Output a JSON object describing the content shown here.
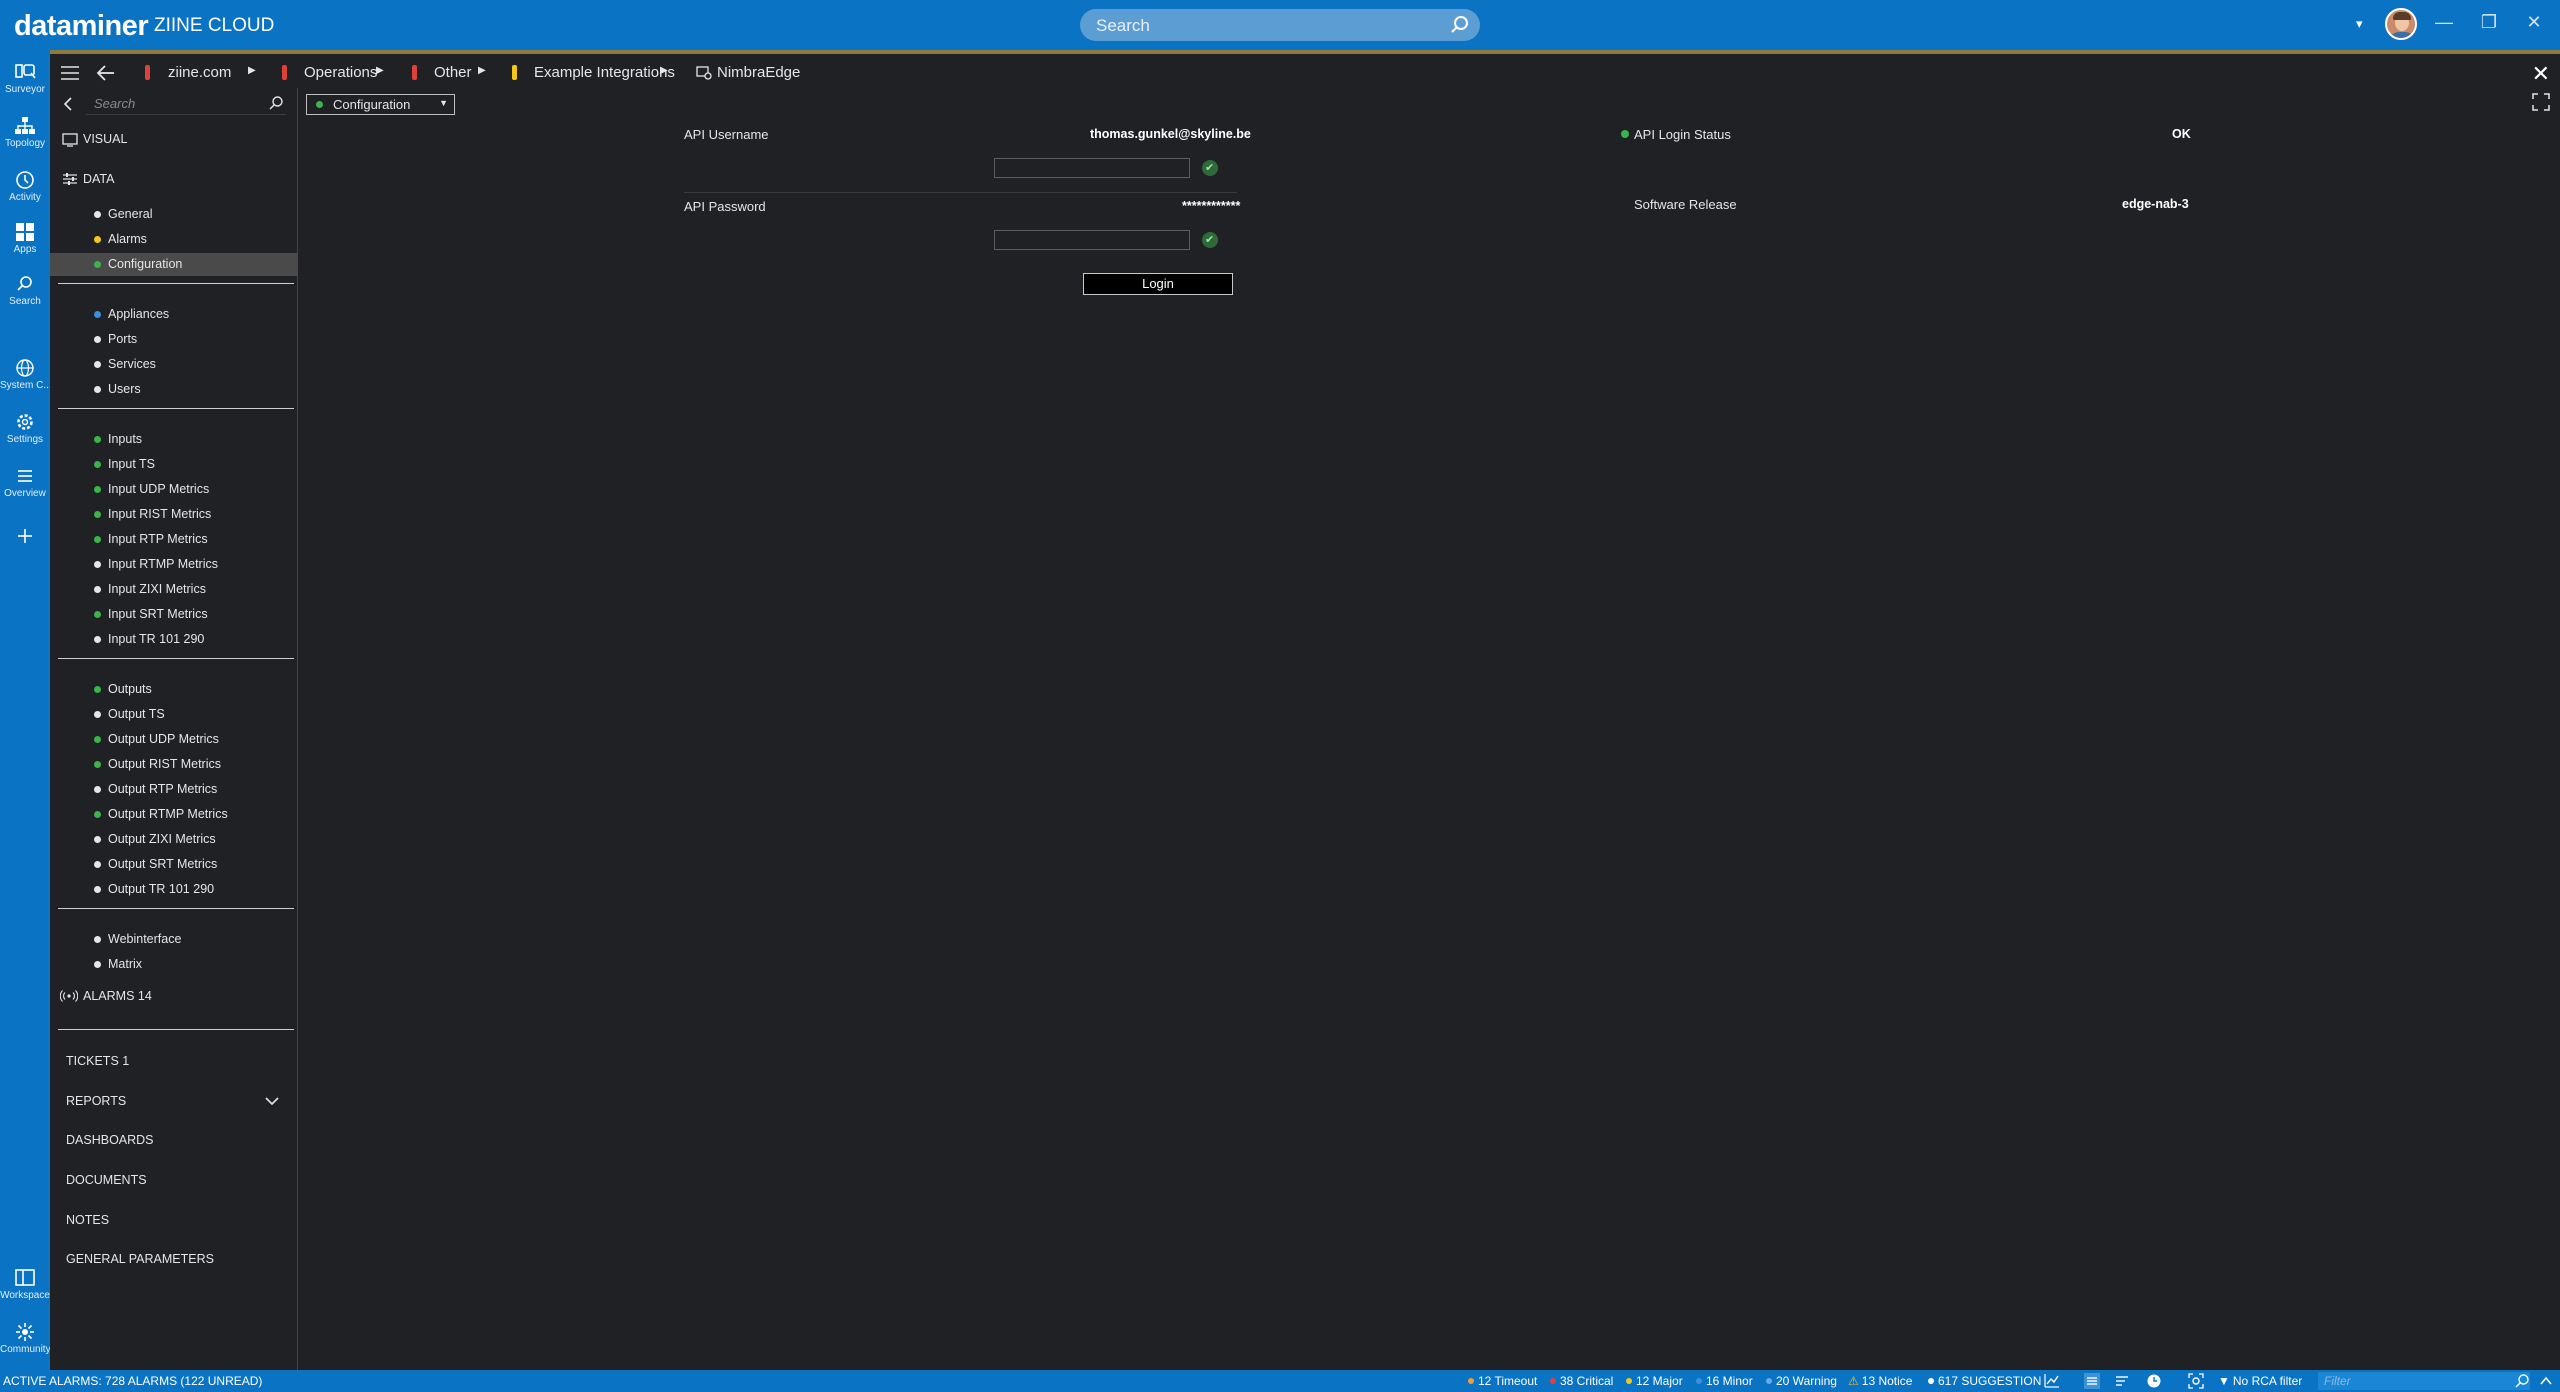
{
  "app": {
    "brand": "dataminer",
    "system_name": "ZIINE CLOUD",
    "search_placeholder": "Search",
    "colors": {
      "accent": "#0a73c4",
      "ok": "#3ab54a",
      "alarm_critical": "#e0403a",
      "alarm_major": "#f5c518",
      "alarm_minor": "#3a8fe0"
    }
  },
  "rail": {
    "items": [
      {
        "label": "Surveyor",
        "icon": "surveyor-icon"
      },
      {
        "label": "Topology",
        "icon": "topology-icon"
      },
      {
        "label": "Activity",
        "icon": "activity-icon"
      },
      {
        "label": "Apps",
        "icon": "apps-icon"
      },
      {
        "label": "Search",
        "icon": "search-icon"
      },
      {
        "label": "System C...",
        "icon": "globe-icon"
      },
      {
        "label": "Settings",
        "icon": "gear-icon"
      },
      {
        "label": "Overview",
        "icon": "list-icon"
      },
      {
        "label": "",
        "icon": "plus-icon"
      },
      {
        "label": "Workspace",
        "icon": "workspace-icon"
      },
      {
        "label": "Community",
        "icon": "community-icon"
      }
    ]
  },
  "breadcrumb": {
    "items": [
      {
        "label": "ziine.com",
        "flag_color": "#e0403a"
      },
      {
        "label": "Operations",
        "flag_color": "#e0403a"
      },
      {
        "label": "Other",
        "flag_color": "#e0403a"
      },
      {
        "label": "Example Integrations",
        "flag_color": "#f5c518"
      },
      {
        "label": "NimbraEdge",
        "flag_color": ""
      }
    ]
  },
  "sidepanel": {
    "search_placeholder": "Search",
    "visual_label": "VISUAL",
    "data_label": "DATA",
    "groups": [
      [
        {
          "label": "General",
          "dot": "#e6e6e6"
        },
        {
          "label": "Alarms",
          "dot": "#f5c518"
        },
        {
          "label": "Configuration",
          "dot": "#3ab54a",
          "selected": true
        }
      ],
      [
        {
          "label": "Appliances",
          "dot": "#3a8fe0"
        },
        {
          "label": "Ports",
          "dot": "#e6e6e6"
        },
        {
          "label": "Services",
          "dot": "#e6e6e6"
        },
        {
          "label": "Users",
          "dot": "#e6e6e6"
        }
      ],
      [
        {
          "label": "Inputs",
          "dot": "#3ab54a"
        },
        {
          "label": "Input TS",
          "dot": "#3ab54a"
        },
        {
          "label": "Input UDP Metrics",
          "dot": "#3ab54a"
        },
        {
          "label": "Input RIST Metrics",
          "dot": "#3ab54a"
        },
        {
          "label": "Input RTP Metrics",
          "dot": "#3ab54a"
        },
        {
          "label": "Input RTMP Metrics",
          "dot": "#e6e6e6"
        },
        {
          "label": "Input ZIXI Metrics",
          "dot": "#e6e6e6"
        },
        {
          "label": "Input SRT Metrics",
          "dot": "#3ab54a"
        },
        {
          "label": "Input TR 101 290",
          "dot": "#e6e6e6"
        }
      ],
      [
        {
          "label": "Outputs",
          "dot": "#3ab54a"
        },
        {
          "label": "Output TS",
          "dot": "#e6e6e6"
        },
        {
          "label": "Output UDP Metrics",
          "dot": "#3ab54a"
        },
        {
          "label": "Output RIST Metrics",
          "dot": "#3ab54a"
        },
        {
          "label": "Output RTP Metrics",
          "dot": "#e6e6e6"
        },
        {
          "label": "Output RTMP Metrics",
          "dot": "#3ab54a"
        },
        {
          "label": "Output ZIXI Metrics",
          "dot": "#e6e6e6"
        },
        {
          "label": "Output SRT Metrics",
          "dot": "#e6e6e6"
        },
        {
          "label": "Output TR 101 290",
          "dot": "#e6e6e6"
        }
      ],
      [
        {
          "label": "Webinterface",
          "dot": "#e6e6e6"
        },
        {
          "label": "Matrix",
          "dot": "#e6e6e6"
        }
      ]
    ],
    "alarms_label": "ALARMS 14",
    "bottom_items": [
      {
        "label": "TICKETS 1"
      },
      {
        "label": "REPORTS",
        "expandable": true
      },
      {
        "label": "DASHBOARDS"
      },
      {
        "label": "DOCUMENTS"
      },
      {
        "label": "NOTES"
      },
      {
        "label": "GENERAL PARAMETERS"
      }
    ]
  },
  "main": {
    "page_selector": "Configuration",
    "api_username_label": "API Username",
    "api_username_value": "thomas.gunkel@skyline.be",
    "api_password_label": "API Password",
    "api_password_value": "************",
    "login_label": "Login",
    "api_login_status_label": "API Login Status",
    "api_login_status_value": "OK",
    "software_release_label": "Software Release",
    "software_release_value": "edge-nab-3"
  },
  "statusbar": {
    "active_alarms": "ACTIVE ALARMS: 728 ALARMS (122 UNREAD)",
    "counts": [
      {
        "label": "12 Timeout",
        "dot": "#f0a030"
      },
      {
        "label": "38 Critical",
        "dot": "#e0403a"
      },
      {
        "label": "12 Major",
        "dot": "#f5c518"
      },
      {
        "label": "16 Minor",
        "dot": "#3a8fe0"
      },
      {
        "label": "20 Warning",
        "dot": "#6aa8e8"
      },
      {
        "label": "13 Notice",
        "dot": ""
      },
      {
        "label": "617 SUGGESTION",
        "dot": "#ffffff"
      }
    ],
    "rca_filter": "No RCA filter",
    "filter_placeholder": "Filter"
  }
}
